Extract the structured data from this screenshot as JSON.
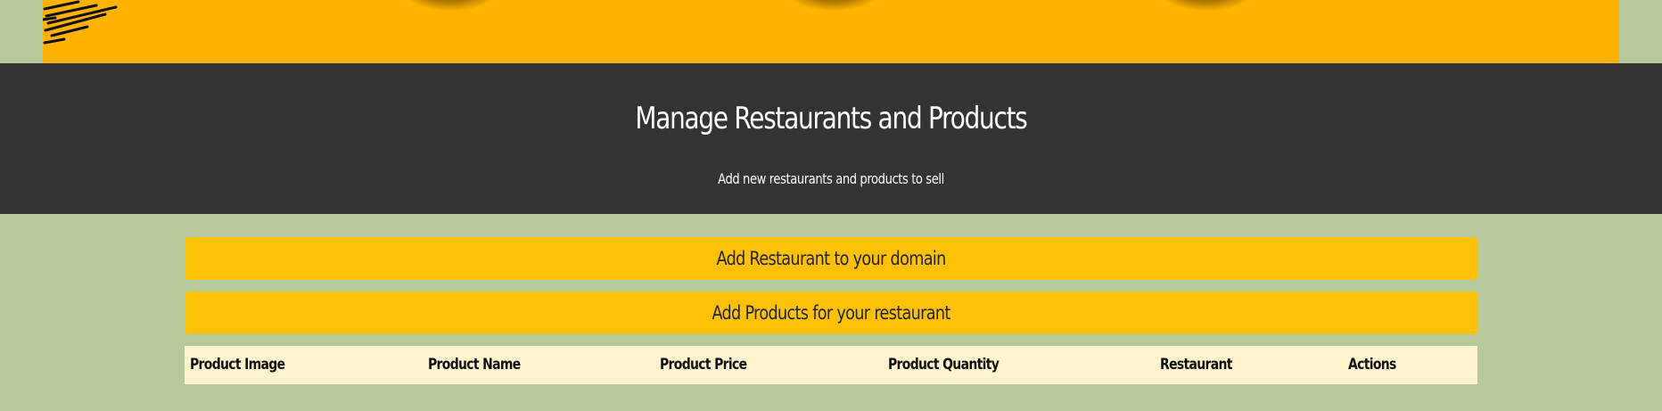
{
  "hero": {
    "decoration": "food-plates-banner"
  },
  "header": {
    "title": "Manage Restaurants and Products",
    "subtitle": "Add new restaurants and products to sell"
  },
  "actions": {
    "add_restaurant": "Add Restaurant to your domain",
    "add_products": "Add Products for your restaurant"
  },
  "table": {
    "columns": [
      "Product Image",
      "Product Name",
      "Product Price",
      "Product Quantity",
      "Restaurant",
      "Actions"
    ],
    "rows": []
  },
  "colors": {
    "page_background": "#b5c99a",
    "hero_background": "#ffb300",
    "header_background": "#333333",
    "button_background": "#ffc107",
    "table_header_background": "#fff3cd"
  }
}
